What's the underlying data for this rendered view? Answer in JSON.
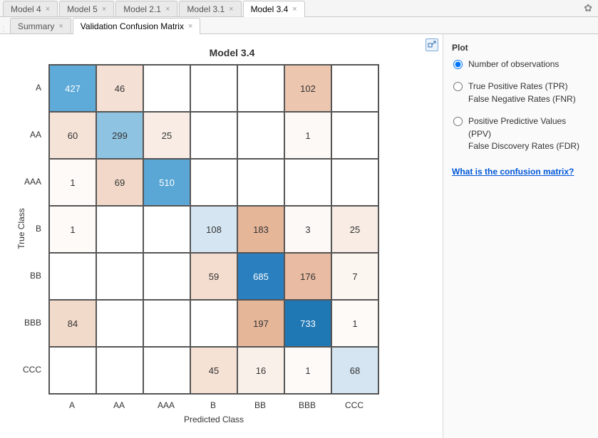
{
  "top_tabs": [
    "Model 4",
    "Model 5",
    "Model 2.1",
    "Model 3.1",
    "Model 3.4"
  ],
  "top_active_index": 4,
  "sub_tabs": [
    "Summary",
    "Validation Confusion Matrix"
  ],
  "sub_active_index": 1,
  "side": {
    "heading": "Plot",
    "options": [
      "Number of observations",
      "True Positive Rates (TPR)\nFalse Negative Rates (FNR)",
      "Positive Predictive Values (PPV)\nFalse Discovery Rates (FDR)"
    ],
    "selected": 0,
    "help_link": "What is the confusion matrix?"
  },
  "chart_data": {
    "type": "heatmap",
    "title": "Model 3.4",
    "xlabel": "Predicted Class",
    "ylabel": "True Class",
    "categories": [
      "A",
      "AA",
      "AAA",
      "B",
      "BB",
      "BBB",
      "CCC"
    ],
    "matrix": [
      [
        427,
        46,
        null,
        null,
        null,
        102,
        null
      ],
      [
        60,
        299,
        25,
        null,
        null,
        1,
        null
      ],
      [
        1,
        69,
        510,
        null,
        null,
        null,
        null
      ],
      [
        1,
        null,
        null,
        108,
        183,
        3,
        25
      ],
      [
        null,
        null,
        null,
        59,
        685,
        176,
        7
      ],
      [
        84,
        null,
        null,
        null,
        197,
        733,
        1
      ],
      [
        null,
        null,
        null,
        45,
        16,
        1,
        68
      ]
    ],
    "colors": [
      [
        "#5eaad8",
        "#f4e0d4",
        "",
        "",
        "",
        "#ecc6af",
        ""
      ],
      [
        "#f5e3d8",
        "#8ec3e2",
        "#f8ece4",
        "",
        "",
        "#fdf9f6",
        ""
      ],
      [
        "#fdfaf8",
        "#f1d8c8",
        "#5aa7d6",
        "",
        "",
        "",
        ""
      ],
      [
        "#fdfaf8",
        "",
        "",
        "#d5e6f2",
        "#e6b699",
        "#fdf9f6",
        "#f8ece4"
      ],
      [
        "",
        "",
        "",
        "#f4ddcf",
        "#2a7fbf",
        "#e8bba2",
        "#fcf6f1"
      ],
      [
        "#f2dacb",
        "",
        "",
        "",
        "#e6b699",
        "#1f77b4",
        "#fdfaf8"
      ],
      [
        "",
        "",
        "",
        "#f5e2d5",
        "#faf0ea",
        "#fdfaf8",
        "#d5e6f2"
      ]
    ],
    "text_colors": [
      [
        "#fff",
        "",
        "",
        "",
        "",
        "",
        ""
      ],
      [
        "",
        "",
        "",
        "",
        "",
        "",
        ""
      ],
      [
        "",
        "",
        "#fff",
        "",
        "",
        "",
        ""
      ],
      [
        "",
        "",
        "",
        "",
        "",
        "",
        ""
      ],
      [
        "",
        "",
        "",
        "",
        "#fff",
        "",
        ""
      ],
      [
        "",
        "",
        "",
        "",
        "",
        "#fff",
        ""
      ],
      [
        "",
        "",
        "",
        "",
        "",
        "",
        ""
      ]
    ]
  }
}
